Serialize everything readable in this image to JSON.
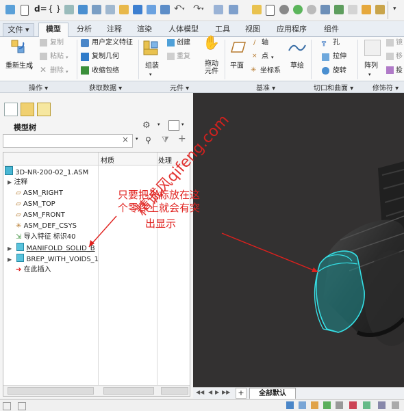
{
  "quick_access": {
    "icons": [
      "new-file-icon",
      "dimension-icon",
      "braces-icon",
      "undo-icon",
      "redo-icon",
      "regenerate-icon",
      "open-icon",
      "save-icon",
      "window-icon",
      "settings-icon"
    ],
    "dimension_text": "d=",
    "braces_text": "{ }"
  },
  "tabs": [
    "文件 ▾",
    "模型",
    "分析",
    "注释",
    "渲染",
    "人体模型",
    "工具",
    "视图",
    "应用程序",
    "组件"
  ],
  "active_tab": "模型",
  "ribbon": {
    "regenerate": "重新生成",
    "copy": "复制",
    "paste": "粘贴",
    "delete": "删除",
    "user_feature": "用户定义特征",
    "copy_geometry": "复制几何",
    "shrinkwrap": "收缩包络",
    "assemble": "组装",
    "create": "创建",
    "repeat": "重复",
    "drag_components": "拖动元件",
    "plane": "平面",
    "axis": "轴",
    "point": "点",
    "csys": "坐标系",
    "sketch": "草绘",
    "hole": "孔",
    "extrude": "拉伸",
    "revolve": "旋转",
    "pattern": "阵列",
    "mirror": "镜",
    "move": "移",
    "project": "投"
  },
  "groups": [
    "操作 ▾",
    "获取数据 ▾",
    "元件 ▾",
    "基准 ▾",
    "切口和曲面 ▾",
    "修饰符 ▾"
  ],
  "panel": {
    "title": "模型树",
    "search_placeholder": "",
    "clear": "×",
    "col_material": "材质",
    "col_process": "处理"
  },
  "tree": [
    {
      "label": "3D-NR-200-02_1.ASM",
      "icon": "assembly-icon"
    },
    {
      "label": "注释",
      "icon": "none"
    },
    {
      "label": "ASM_RIGHT",
      "icon": "datum-plane-icon"
    },
    {
      "label": "ASM_TOP",
      "icon": "datum-plane-icon"
    },
    {
      "label": "ASM_FRONT",
      "icon": "datum-plane-icon"
    },
    {
      "label": "ASM_DEF_CSYS",
      "icon": "csys-icon"
    },
    {
      "label": "导入特征 标识40",
      "icon": "import-icon"
    },
    {
      "label": "MANIFOLD_SOLID_B",
      "icon": "part-icon"
    },
    {
      "label": "BREP_WITH_VOIDS_1",
      "icon": "part-icon"
    },
    {
      "label": "在此插入",
      "icon": "insert-arrow-icon"
    }
  ],
  "annotation": {
    "line1": "只要把光标放在这",
    "line2": "个零件上就会有突",
    "line3": "出显示"
  },
  "watermark": "精诚风qifeng.com",
  "bottombar": {
    "add": "+",
    "view_tab": "全部默认"
  }
}
